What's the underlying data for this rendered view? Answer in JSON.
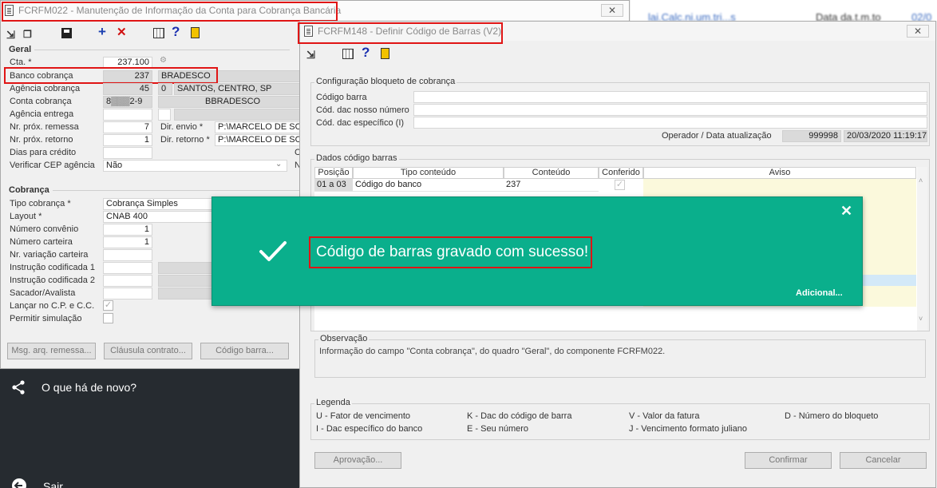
{
  "colors": {
    "toast_bg": "#0aaf8c",
    "highlight_red": "#e01515",
    "sidebar_bg": "#262b30"
  },
  "back_page": {
    "text1": "lai.Calc.ni.um.tri...s",
    "text2": "Data da.t.m.to",
    "text3": "02/0"
  },
  "win1": {
    "title": "FCRFM022 - Manutenção de Informação da Conta para Cobrança Bancária",
    "close": "✕",
    "geral": {
      "heading": "Geral",
      "cta_label": "Cta. *",
      "cta_value": "237.100",
      "banco_label": "Banco cobrança",
      "banco_code": "237",
      "banco_name": "BRADESCO",
      "agencia_label": "Agência cobrança",
      "agencia_code": "45",
      "agencia_dig": "0",
      "agencia_name": "SANTOS, CENTRO, SP",
      "conta_label": "Conta cobrança",
      "conta_value": "8▒▒▒2-9",
      "conta_name": "BBRADESCO",
      "agencia_entrega_label": "Agência entrega",
      "remessa_label": "Nr. próx. remessa",
      "remessa_value": "7",
      "retorno_label": "Nr. próx. retorno",
      "retorno_value": "1",
      "dias_label": "Dias para crédito",
      "cep_label": "Verificar CEP agência",
      "cep_value": "Não",
      "dir_envio_label": "Dir. envio *",
      "dir_envio_value": "P:\\MARCELO DE SOUZ",
      "dir_retorno_label": "Dir. retorno *",
      "dir_retorno_value": "P:\\MARCELO DE SOUZ",
      "c_label": "C",
      "n_label": "N"
    },
    "cobranca": {
      "heading": "Cobrança",
      "tipo_label": "Tipo cobrança *",
      "tipo_value": "Cobrança Simples",
      "layout_label": "Layout *",
      "layout_value": "CNAB 400",
      "convenio_label": "Número convênio",
      "convenio_value": "1",
      "carteira_label": "Número carteira",
      "carteira_value": "1",
      "variacao_label": "Nr. variação carteira",
      "instr1_label": "Instrução codificada 1",
      "instr2_label": "Instrução codificada 2",
      "sacador_label": "Sacador/Avalista",
      "lancar_label": "Lançar no C.P. e C.C.",
      "permitir_label": "Permitir simulação"
    },
    "buttons": {
      "msg": "Msg. arq. remessa...",
      "clausula": "Cláusula contrato...",
      "codigo": "Código barra..."
    }
  },
  "sidebar": {
    "novo": "O que há de novo?",
    "sair": "Sair"
  },
  "win2": {
    "title": "FCRFM148 - Definir Código de Barras (V2)",
    "close": "✕",
    "config": {
      "title": "Configuração bloqueto de cobrança",
      "codigo_barra_label": "Código barra",
      "dac_nosso_label": "Cód. dac nosso número",
      "dac_esp_label": "Cód. dac específico (I)",
      "operador_label": "Operador / Data atualização",
      "operador_value": "999998",
      "data_value": "20/03/2020 11:19:17"
    },
    "dados": {
      "title": "Dados código barras",
      "columns": [
        "Posição",
        "Tipo conteúdo",
        "Conteúdo",
        "Conferido",
        "Aviso"
      ],
      "row1": {
        "posicao": "01 a 03",
        "tipo": "Código do banco",
        "conteudo": "237"
      }
    },
    "observacao": {
      "title": "Observação",
      "text": "Informação do campo \"Conta cobrança\", do quadro \"Geral\", do componente FCRFM022."
    },
    "legenda": {
      "title": "Legenda",
      "items": [
        "U - Fator de vencimento",
        "K - Dac do código de barra",
        "V - Valor da fatura",
        "D - Número do bloqueto",
        "I - Dac específico do banco",
        "E - Seu número",
        "J - Vencimento formato juliano"
      ]
    },
    "buttons": {
      "aprovacao": "Aprovação...",
      "confirmar": "Confirmar",
      "cancelar": "Cancelar"
    }
  },
  "toast": {
    "message": "Código de barras gravado com sucesso!",
    "link": "Adicional...",
    "close": "✕"
  }
}
